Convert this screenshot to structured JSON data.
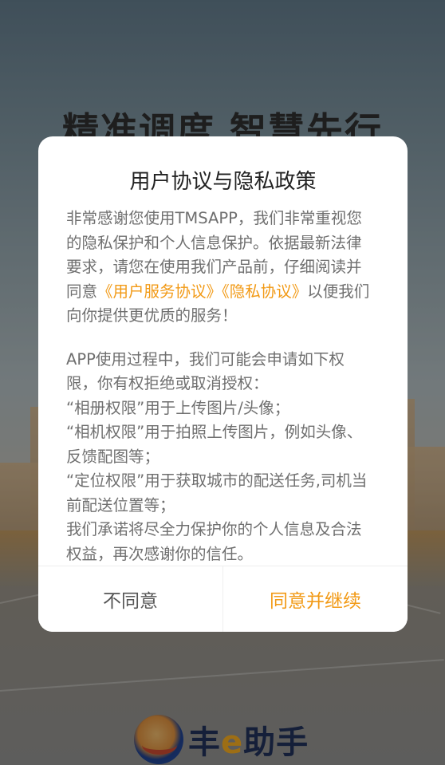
{
  "splash": {
    "slogan": "精准调度    智慧先行",
    "brand_name_prefix": "丰",
    "brand_name_e": "e",
    "brand_name_suffix": "助手",
    "brand_logo_icon": "fengehelper-logo-icon"
  },
  "dialog": {
    "title": "用户协议与隐私政策",
    "intro_text": "非常感谢您使用TMSAPP，我们非常重视您的隐私保护和个人信息保护。依据最新法律要求，请您在使用我们产品前，仔细阅读并同意",
    "link_user_agreement": "《用户服务协议》",
    "link_privacy_policy": "《隐私协议》",
    "intro_tail": "以便我们向你提供更优质的服务！",
    "permissions": [
      "APP使用过程中，我们可能会申请如下权限，你有权拒绝或取消授权：",
      "“相册权限”用于上传图片/头像；",
      "“相机权限”用于拍照上传图片，例如头像、反馈配图等；",
      "“定位权限”用于获取城市的配送任务,司机当前配送位置等；",
      "我们承诺将尽全力保护你的个人信息及合法权益，再次感谢你的信任。"
    ],
    "disagree_label": "不同意",
    "agree_label": "同意并继续"
  },
  "colors": {
    "accent": "#f29a16",
    "body_text": "#6f6f6f",
    "title_text": "#222222",
    "brand_blue": "#1f2f55"
  }
}
